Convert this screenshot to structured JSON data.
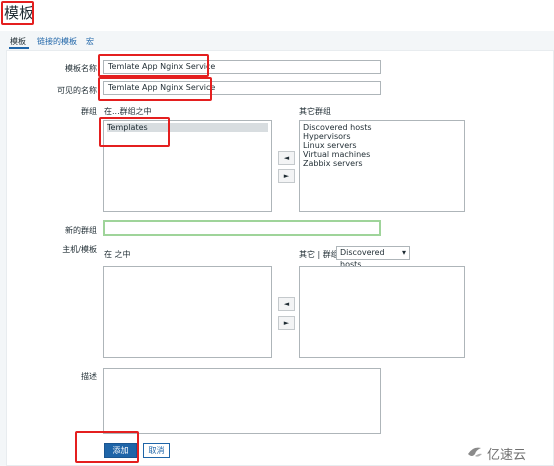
{
  "page": {
    "title": "模板"
  },
  "tabs": [
    {
      "label": "模板"
    },
    {
      "label": "链接的模板"
    },
    {
      "label": "宏"
    }
  ],
  "form": {
    "template_name": {
      "label": "模板名称",
      "value": "Temlate App Nginx Service"
    },
    "visible_name": {
      "label": "可见的名称",
      "value": "Temlate App Nginx Service"
    },
    "groups": {
      "label": "群组",
      "in_label": "在...群组之中",
      "other_label": "其它群组",
      "selected": [
        "Templates"
      ],
      "others": [
        "Discovered hosts",
        "Hypervisors",
        "Linux servers",
        "Virtual machines",
        "Zabbix servers"
      ]
    },
    "new_group": {
      "label": "新的群组",
      "value": ""
    },
    "hosts": {
      "label": "主机/模板",
      "in_label": "在 之中",
      "other_label": "其它 | 群组",
      "group_select": "Discovered hosts"
    },
    "description": {
      "label": "描述",
      "value": ""
    },
    "move_left": "◄",
    "move_right": "►",
    "add_button": "添加",
    "cancel_button": "取消"
  },
  "watermark": {
    "text": "亿速云"
  },
  "colors": {
    "accent": "#1f65a8",
    "highlight": "#e41f1f",
    "input_focus": "#9fd49a"
  },
  "icons": {
    "dropdown": "chevron-down-icon",
    "resize": "resize-handle-icon",
    "logo": "yisu-logo-icon"
  }
}
